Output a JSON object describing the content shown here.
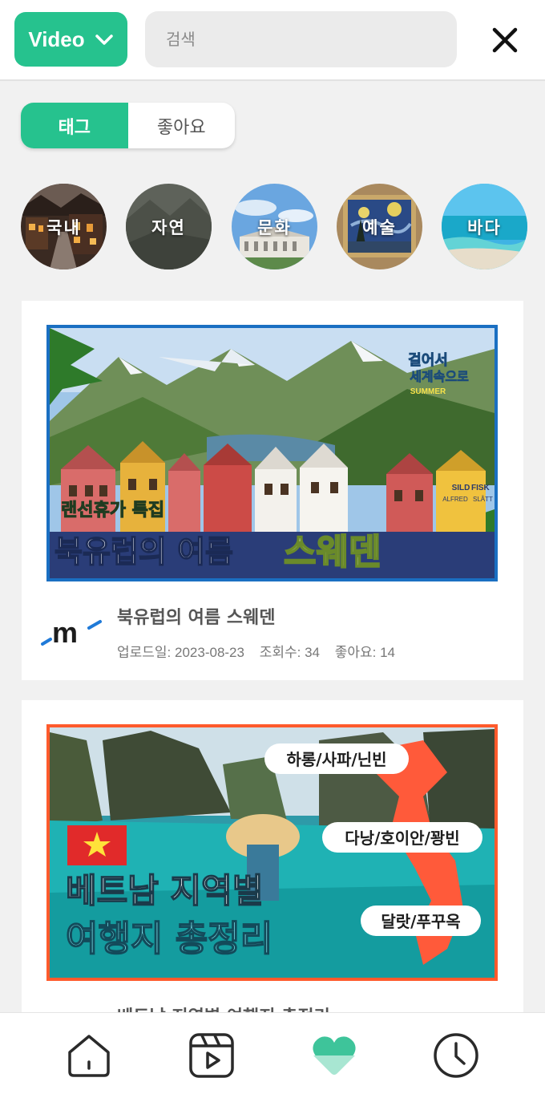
{
  "header": {
    "mode_label": "Video",
    "search_placeholder": "검색",
    "close_icon": "close-icon"
  },
  "segment": {
    "tabs": [
      {
        "label": "태그",
        "active": true
      },
      {
        "label": "좋아요",
        "active": false
      }
    ]
  },
  "categories": [
    {
      "label": "국내"
    },
    {
      "label": "자연"
    },
    {
      "label": "문화"
    },
    {
      "label": "예술"
    },
    {
      "label": "바다"
    }
  ],
  "videos": [
    {
      "thumbnail": {
        "caption_top": "랜선휴가 특집",
        "caption_main": "북유럽의 여름",
        "caption_highlight": "스웨덴",
        "badge_line1": "걸어서",
        "badge_line2": "세계속으로",
        "badge_line3": "SUMMER",
        "sign1": "SILD",
        "sign2": "FISK",
        "sign3": "ALFRED",
        "sign4": "SLÅTT"
      },
      "title": "북유럽의 여름 스웨덴",
      "upload_date": "업로드일: 2023-08-23",
      "views": "조회수: 34",
      "likes": "좋아요: 14"
    },
    {
      "thumbnail": {
        "caption_line1": "베트남 지역별",
        "caption_line2": "여행지 총정리",
        "tag1": "하롱/사파/닌빈",
        "tag2": "다낭/호이안/꽝빈",
        "tag3": "달랏/푸꾸옥"
      },
      "title": "베트남 지역별 여행지 총정리"
    }
  ],
  "bottom_nav": [
    {
      "icon": "home-icon"
    },
    {
      "icon": "video-icon"
    },
    {
      "icon": "heart-icon",
      "active": true
    },
    {
      "icon": "clock-icon"
    }
  ],
  "colors": {
    "accent": "#26c28e",
    "heart_active": "#3ec49a"
  }
}
